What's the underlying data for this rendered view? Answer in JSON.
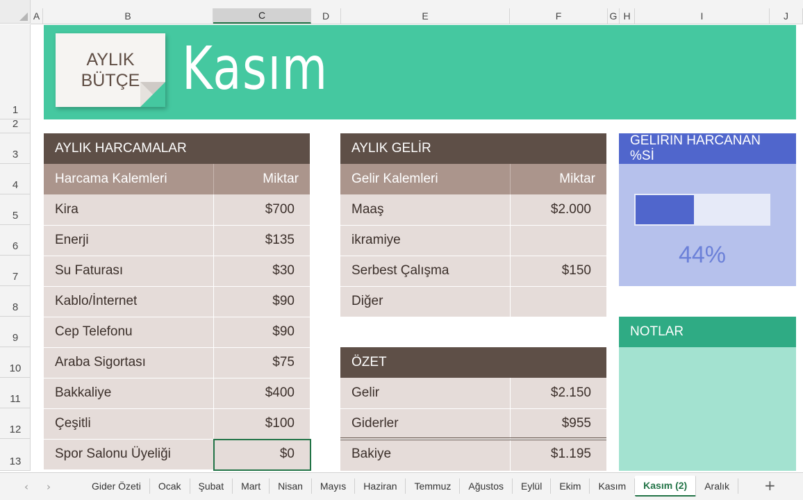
{
  "columns": [
    "A",
    "B",
    "C",
    "D",
    "E",
    "F",
    "G",
    "H",
    "I",
    "J"
  ],
  "rows": [
    "1",
    "2",
    "3",
    "4",
    "5",
    "6",
    "7",
    "8",
    "9",
    "10",
    "11",
    "12",
    "13"
  ],
  "selected_column": "C",
  "banner": {
    "badge_line1": "AYLIK",
    "badge_line2": "BÜTÇE",
    "title": "Kasım"
  },
  "expenses": {
    "header": "AYLIK HARCAMALAR",
    "col_item": "Harcama Kalemleri",
    "col_amount": "Miktar",
    "rows": [
      {
        "item": "Kira",
        "amount": "$700"
      },
      {
        "item": "Enerji",
        "amount": "$135"
      },
      {
        "item": "Su Faturası",
        "amount": "$30"
      },
      {
        "item": "Kablo/İnternet",
        "amount": "$90"
      },
      {
        "item": "Cep Telefonu",
        "amount": "$90"
      },
      {
        "item": "Araba Sigortası",
        "amount": "$75"
      },
      {
        "item": "Bakkaliye",
        "amount": "$400"
      },
      {
        "item": "Çeşitli",
        "amount": "$100"
      },
      {
        "item": "Spor Salonu Üyeliği",
        "amount": "$0"
      }
    ]
  },
  "income": {
    "header": "AYLIK GELİR",
    "col_item": "Gelir Kalemleri",
    "col_amount": "Miktar",
    "rows": [
      {
        "item": "Maaş",
        "amount": "$2.000"
      },
      {
        "item": "ikramiye",
        "amount": ""
      },
      {
        "item": "Serbest Çalışma",
        "amount": "$150"
      },
      {
        "item": "Diğer",
        "amount": ""
      }
    ]
  },
  "summary": {
    "header": "ÖZET",
    "rows": [
      {
        "item": "Gelir",
        "amount": "$2.150"
      },
      {
        "item": "Giderler",
        "amount": "$955"
      },
      {
        "item": "Bakiye",
        "amount": "$1.195"
      }
    ]
  },
  "spent_percent": {
    "header": "GELIRIN HARCANAN %Sİ",
    "value": 0.44,
    "label": "44%",
    "bar_color": "#5066cc"
  },
  "notes": {
    "header": "NOTLAR"
  },
  "sheet_tabs": [
    "Gider Özeti",
    "Ocak",
    "Şubat",
    "Mart",
    "Nisan",
    "Mayıs",
    "Haziran",
    "Temmuz",
    "Ağustos",
    "Eylül",
    "Ekim",
    "Kasım",
    "Kasım (2)",
    "Aralık"
  ],
  "active_tab": "Kasım (2)",
  "add_sheet_label": "+",
  "nav_prev": "‹",
  "nav_next": "›",
  "colors": {
    "banner": "#45c8a0",
    "table_header": "#5e4f47",
    "table_colheader": "#ab958c",
    "table_body": "#e5dcd9",
    "notes_header": "#2fab84",
    "notes_body": "#a3e2d0"
  }
}
